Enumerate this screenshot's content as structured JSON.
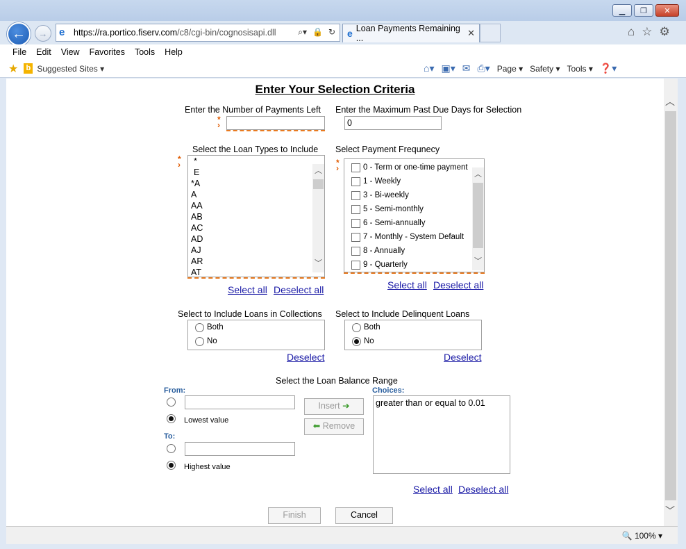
{
  "browser": {
    "url_host": "https://ra.portico.fiserv.com",
    "url_path": "/c8/cgi-bin/cognosisapi.dll",
    "tab_title": "Loan Payments Remaining ...",
    "menu": [
      "File",
      "Edit",
      "View",
      "Favorites",
      "Tools",
      "Help"
    ],
    "suggested_sites": "Suggested Sites",
    "cmd": {
      "page": "Page",
      "safety": "Safety",
      "tools": "Tools"
    },
    "zoom": "100%"
  },
  "page": {
    "title": "Enter Your Selection Criteria",
    "payments_left_label": "Enter the Number of Payments Left",
    "payments_left_value": "",
    "max_past_due_label": "Enter the Maximum Past Due Days for Selection",
    "max_past_due_value": "0",
    "loan_types_label": "Select the Loan Types to Include",
    "loan_types": [
      "*",
      "E",
      "*A",
      "A",
      "AA",
      "AB",
      "AC",
      "AD",
      "AJ",
      "AR",
      "AT"
    ],
    "payment_freq_label": "Select Payment Frequnecy",
    "payment_freqs": [
      "0 - Term or one-time payment",
      "1 - Weekly",
      "3 - Bi-weekly",
      "5 - Semi-monthly",
      "6 - Semi-annually",
      "7 - Monthly - System Default",
      "8 - Annually",
      "9 - Quarterly"
    ],
    "select_all": "Select all",
    "deselect_all": "Deselect all",
    "collections_label": "Select to Include Loans in Collections",
    "collections_options": [
      "Both",
      "No"
    ],
    "delinquent_label": "Select to Include Delinquent Loans",
    "delinquent_options": [
      "Both",
      "No"
    ],
    "delinquent_selected": "No",
    "deselect": "Deselect",
    "balance_range_label": "Select the Loan Balance Range",
    "from_label": "From:",
    "to_label": "To:",
    "lowest_value": "Lowest value",
    "highest_value": "Highest value",
    "insert": "Insert",
    "remove": "Remove",
    "choices_label": "Choices:",
    "choices": [
      "greater than or equal to 0.01"
    ],
    "finish": "Finish",
    "cancel": "Cancel"
  }
}
